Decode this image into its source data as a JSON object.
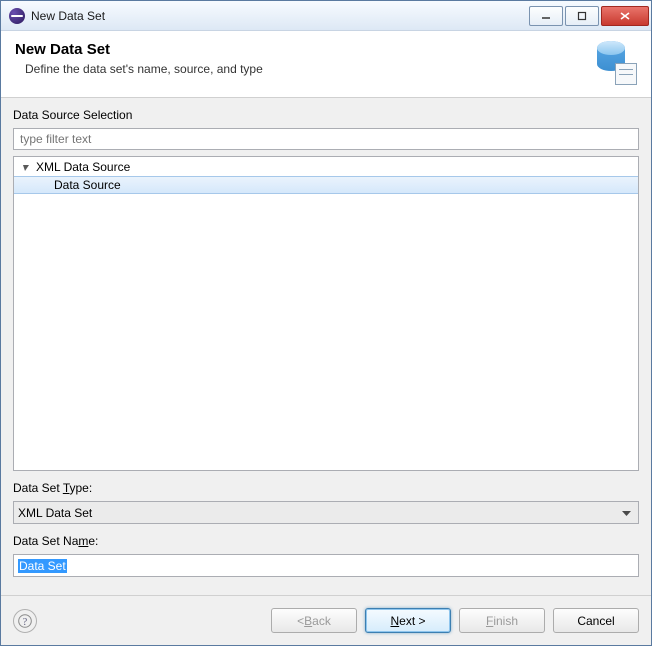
{
  "window": {
    "title": "New Data Set"
  },
  "header": {
    "title": "New Data Set",
    "subtitle": "Define the data set's name, source, and type"
  },
  "source": {
    "section_label": "Data Source Selection",
    "filter_placeholder": "type filter text",
    "tree": {
      "parent_label": "XML Data Source",
      "child_label": "Data Source"
    }
  },
  "type": {
    "label_prefix": "Data Set ",
    "label_mnemonic": "T",
    "label_suffix": "ype:",
    "selected": "XML Data Set"
  },
  "name": {
    "label_prefix": "Data Set Na",
    "label_mnemonic": "m",
    "label_suffix": "e:",
    "value": "Data Set"
  },
  "buttons": {
    "back_prefix": "< ",
    "back_mnemonic": "B",
    "back_suffix": "ack",
    "next_mnemonic": "N",
    "next_suffix": "ext >",
    "finish_mnemonic": "F",
    "finish_suffix": "inish",
    "cancel": "Cancel"
  }
}
